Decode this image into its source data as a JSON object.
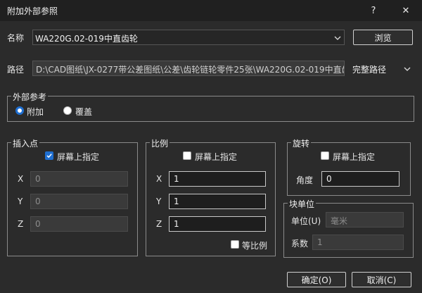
{
  "window": {
    "title": "附加外部参照",
    "help": "?",
    "close": "✕"
  },
  "name": {
    "label": "名称",
    "value": "WA220G.02-019中直齿轮",
    "browse": "浏览"
  },
  "path": {
    "label": "路径",
    "value": "D:\\CAD图纸\\JX-0277带公差图纸\\公差\\齿轮链轮零件25张\\WA220G.02-019中直齿",
    "type": "完整路径"
  },
  "reference": {
    "title": "外部参考",
    "options": [
      {
        "label": "附加",
        "selected": true
      },
      {
        "label": "覆盖",
        "selected": false
      }
    ]
  },
  "insertion": {
    "title": "插入点",
    "specify": "屏幕上指定",
    "specify_checked": true,
    "x_label": "X",
    "x": "0",
    "y_label": "Y",
    "y": "0",
    "z_label": "Z",
    "z": "0"
  },
  "scale": {
    "title": "比例",
    "specify": "屏幕上指定",
    "specify_checked": false,
    "x_label": "X",
    "x": "1",
    "y_label": "Y",
    "y": "1",
    "z_label": "Z",
    "z": "1",
    "uniform": "等比例",
    "uniform_checked": false
  },
  "rotation": {
    "title": "旋转",
    "specify": "屏幕上指定",
    "specify_checked": false,
    "angle_label": "角度",
    "angle": "0"
  },
  "block_unit": {
    "title": "块单位",
    "unit_label": "单位(U)",
    "unit": "毫米",
    "factor_label": "系数",
    "factor": "1"
  },
  "buttons": {
    "ok": "确定(O)",
    "cancel": "取消(C)"
  },
  "colors": {
    "accent": "#1f6fd1",
    "background": "#2b2b2b"
  }
}
